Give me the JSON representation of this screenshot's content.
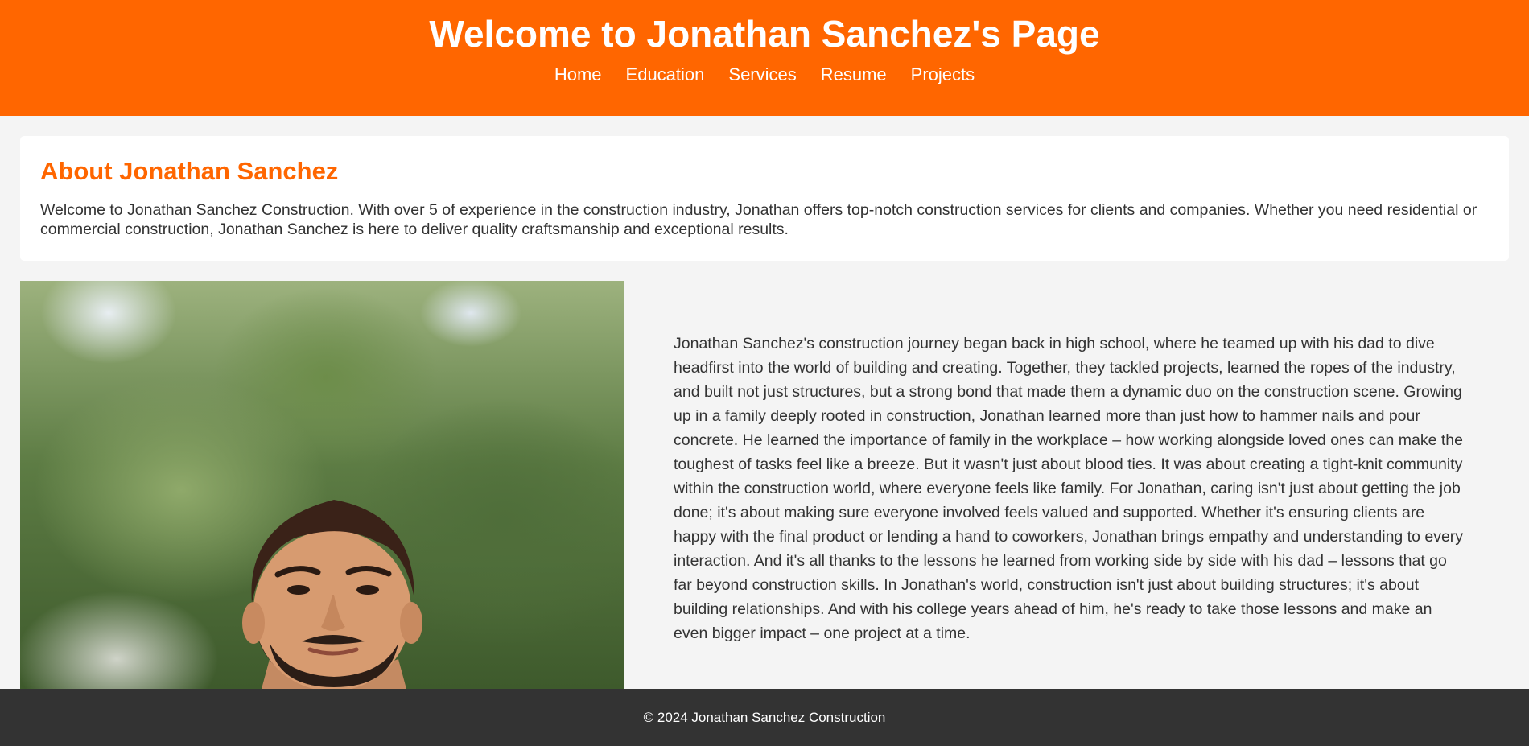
{
  "header": {
    "title": "Welcome to Jonathan Sanchez's Page",
    "nav": [
      "Home",
      "Education",
      "Services",
      "Resume",
      "Projects"
    ]
  },
  "about": {
    "heading": "About Jonathan Sanchez",
    "text": "Welcome to Jonathan Sanchez Construction. With over 5 of experience in the construction industry, Jonathan offers top-notch construction services for clients and companies. Whether you need residential or commercial construction, Jonathan Sanchez is here to deliver quality craftsmanship and exceptional results."
  },
  "story": {
    "text": "Jonathan Sanchez's construction journey began back in high school, where he teamed up with his dad to dive headfirst into the world of building and creating. Together, they tackled projects, learned the ropes of the industry, and built not just structures, but a strong bond that made them a dynamic duo on the construction scene. Growing up in a family deeply rooted in construction, Jonathan learned more than just how to hammer nails and pour concrete. He learned the importance of family in the workplace – how working alongside loved ones can make the toughest of tasks feel like a breeze. But it wasn't just about blood ties. It was about creating a tight-knit community within the construction world, where everyone feels like family. For Jonathan, caring isn't just about getting the job done; it's about making sure everyone involved feels valued and supported. Whether it's ensuring clients are happy with the final product or lending a hand to coworkers, Jonathan brings empathy and understanding to every interaction. And it's all thanks to the lessons he learned from working side by side with his dad – lessons that go far beyond construction skills. In Jonathan's world, construction isn't just about building structures; it's about building relationships. And with his college years ahead of him, he's ready to take those lessons and make an even bigger impact – one project at a time."
  },
  "footer": {
    "text": "© 2024 Jonathan Sanchez Construction"
  },
  "colors": {
    "accent": "#ff6600",
    "footer_bg": "#333333",
    "page_bg": "#f4f4f4"
  }
}
